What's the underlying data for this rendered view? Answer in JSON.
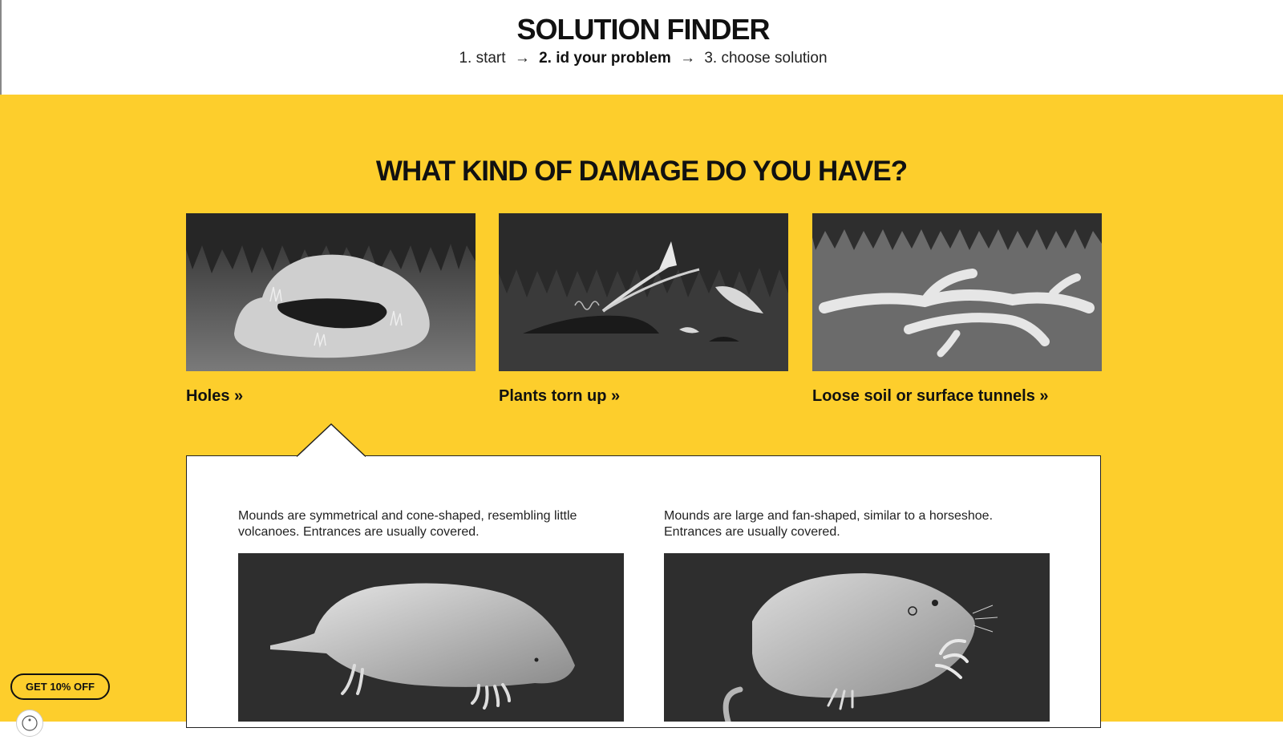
{
  "header": {
    "title": "SOLUTION FINDER",
    "steps": [
      {
        "label": "1. start",
        "active": false
      },
      {
        "label": "2. id your problem",
        "active": true
      },
      {
        "label": "3. choose solution",
        "active": false
      }
    ],
    "arrow_glyph": "→"
  },
  "main": {
    "question": "WHAT KIND OF DAMAGE DO YOU HAVE?",
    "cards": [
      {
        "label": "Holes »",
        "image_icon": "mound-hole-illustration"
      },
      {
        "label": "Plants torn up »",
        "image_icon": "torn-plant-illustration"
      },
      {
        "label": "Loose soil or surface tunnels »",
        "image_icon": "surface-tunnel-illustration"
      }
    ],
    "panel": {
      "items": [
        {
          "description": "Mounds are symmetrical and cone-shaped, resembling little volcanoes. Entrances are usually covered.",
          "image_icon": "mole-illustration"
        },
        {
          "description": "Mounds are large and fan-shaped, similar to a horseshoe. Entrances are usually covered.",
          "image_icon": "gopher-illustration"
        }
      ]
    }
  },
  "promo": {
    "label": "GET 10% OFF"
  },
  "accessibility": {
    "icon": "accessibility-icon"
  },
  "colors": {
    "accent": "#FDCE2C",
    "dark": "#111111",
    "image_bg": "#3b3b3b"
  }
}
